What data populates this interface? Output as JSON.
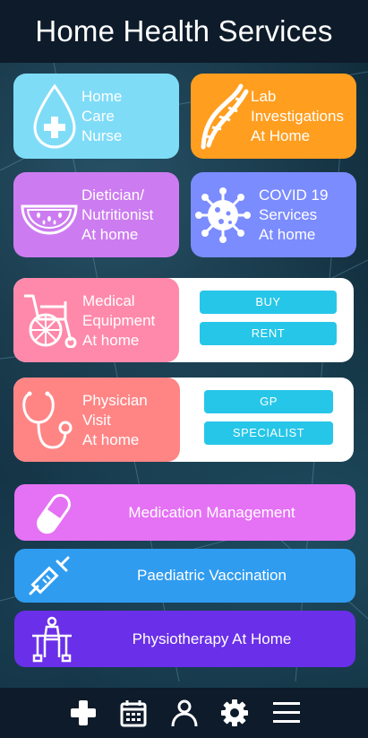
{
  "header": {
    "title": "Home Health Services"
  },
  "tiles": [
    {
      "label": "Home\nCare\nNurse",
      "icon": "nurse-drop-icon",
      "color": "#7fdcf7"
    },
    {
      "label": "Lab\nInvestigations\nAt Home",
      "icon": "dna-icon",
      "color": "#ff9e1f"
    },
    {
      "label": "Dietician/\nNutritionist\nAt home",
      "icon": "watermelon-icon",
      "color": "#cc7cf0"
    },
    {
      "label": "COVID 19\nServices\nAt home",
      "icon": "virus-icon",
      "color": "#7b8cff"
    }
  ],
  "combos": [
    {
      "label": "Medical\nEquipment\nAt home",
      "icon": "wheelchair-icon",
      "color": "#ff89aa",
      "options": [
        "BUY",
        "RENT"
      ]
    },
    {
      "label": "Physician\nVisit\nAt home",
      "icon": "stethoscope-icon",
      "color": "#ff8585",
      "options": [
        "GP",
        "SPECIALIST"
      ]
    }
  ],
  "wide": [
    {
      "label": "Medication Management",
      "icon": "pill-icon",
      "color": "#e571f5"
    },
    {
      "label": "Paediatric Vaccination",
      "icon": "syringe-icon",
      "color": "#2f9cf0"
    },
    {
      "label": "Physiotherapy At Home",
      "icon": "physio-icon",
      "color": "#6a2fe8"
    }
  ],
  "nav": [
    "add-icon",
    "calendar-icon",
    "profile-icon",
    "settings-icon",
    "menu-icon"
  ],
  "colors": {
    "header_bg": "#0d1b2a",
    "pill": "#26c6e8"
  }
}
